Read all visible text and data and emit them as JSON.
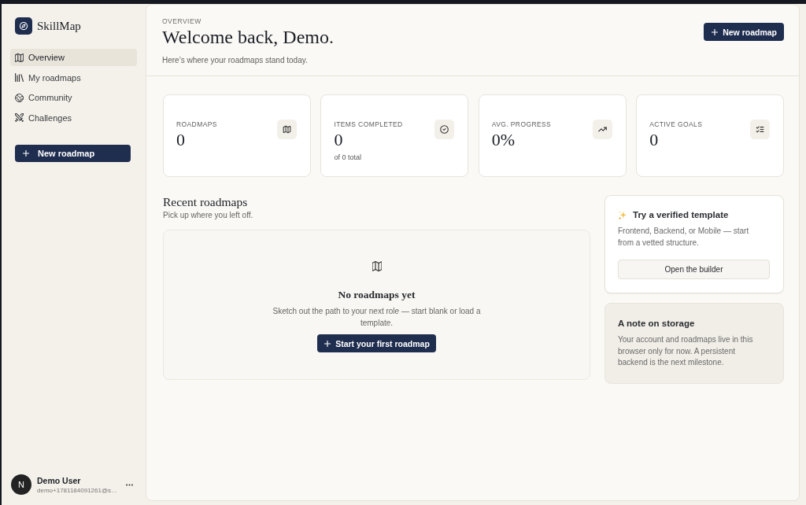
{
  "sidebar": {
    "brand": "SkillMap",
    "nav": [
      {
        "label": "Overview",
        "selected": true
      },
      {
        "label": "My roadmaps",
        "selected": false
      },
      {
        "label": "Community",
        "selected": false
      },
      {
        "label": "Challenges",
        "selected": false
      }
    ],
    "new_button": "New roadmap",
    "user": {
      "initial": "N",
      "name": "Demo User",
      "email": "demo+1781184091261@s…"
    }
  },
  "header": {
    "eyebrow": "OVERVIEW",
    "title": "Welcome back, Demo.",
    "subtitle": "Here’s where your roadmaps stand today.",
    "button": "New roadmap"
  },
  "stats": [
    {
      "label": "ROADMAPS",
      "value": "0"
    },
    {
      "label": "ITEMS COMPLETED",
      "value": "0",
      "note": "of 0 total"
    },
    {
      "label": "AVG. PROGRESS",
      "value": "0%"
    },
    {
      "label": "ACTIVE GOALS",
      "value": "0"
    }
  ],
  "recent": {
    "title": "Recent roadmaps",
    "subtitle": "Pick up where you left off.",
    "empty": {
      "title": "No roadmaps yet",
      "text": "Sketch out the path to your next role — start blank or load a template.",
      "button": "Start your first roadmap"
    }
  },
  "template_card": {
    "title": "Try a verified template",
    "text": "Frontend, Backend, or Mobile — start from a vetted structure.",
    "button": "Open the builder"
  },
  "note_card": {
    "title": "A note on storage",
    "text": "Your account and roadmaps live in this browser only for now. A persistent backend is the next milestone."
  }
}
